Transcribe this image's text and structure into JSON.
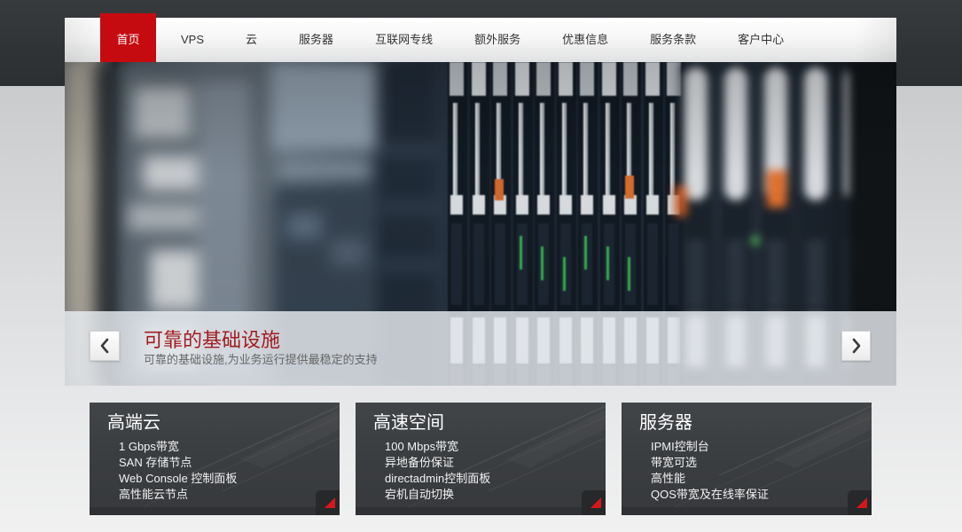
{
  "nav": {
    "items": [
      {
        "label": "首页",
        "active": true
      },
      {
        "label": "VPS",
        "active": false
      },
      {
        "label": "云",
        "active": false
      },
      {
        "label": "服务器",
        "active": false
      },
      {
        "label": "互联网专线",
        "active": false
      },
      {
        "label": "额外服务",
        "active": false
      },
      {
        "label": "优惠信息",
        "active": false
      },
      {
        "label": "服务条款",
        "active": false
      },
      {
        "label": "客户中心",
        "active": false
      }
    ]
  },
  "slider": {
    "prev_icon": "chevron-left-icon",
    "next_icon": "chevron-right-icon",
    "caption": {
      "title": "可靠的基础设施",
      "subtitle": "可靠的基础设施,为业务运行提供最稳定的支持"
    }
  },
  "features": [
    {
      "title": "高端云",
      "items": [
        "1 Gbps带宽",
        "SAN 存储节点",
        "Web Console 控制面板",
        "高性能云节点"
      ],
      "more_icon": "corner-arrow-icon"
    },
    {
      "title": "高速空间",
      "items": [
        "100 Mbps带宽",
        "异地备份保证",
        "directadmin控制面板",
        "宕机自动切换"
      ],
      "more_icon": "corner-arrow-icon"
    },
    {
      "title": "服务器",
      "items": [
        "IPMI控制台",
        "带宽可选",
        "高性能",
        "QOS带宽及在线率保证"
      ],
      "more_icon": "corner-arrow-icon"
    }
  ],
  "colors": {
    "nav_active": "#c60b10",
    "caption_title": "#a21c20",
    "feature_bg": "#3b3e41",
    "corner_triangle": "#d5171c",
    "header_band": "#303336"
  }
}
